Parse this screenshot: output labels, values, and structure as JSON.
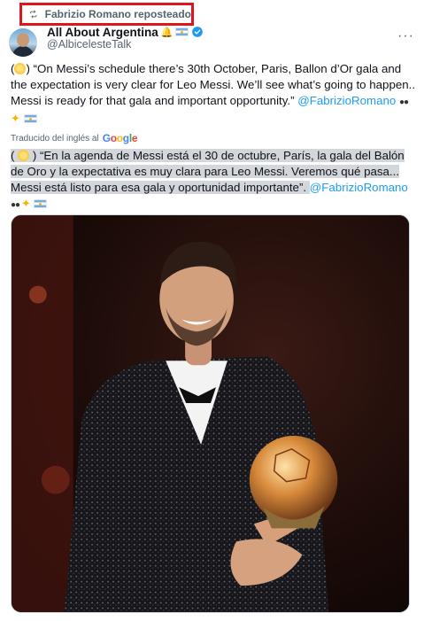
{
  "repost": {
    "label": "Fabrizio Romano reposteado",
    "icon": "repost-icon"
  },
  "author": {
    "display_name": "All About Argentina",
    "handle": "@AlbicelesteTalk",
    "badges": [
      "bell-icon",
      "argentina-flag-icon",
      "verified-badge-icon"
    ],
    "verified_color": "#1d9bf0"
  },
  "more_label": "···",
  "tweet": {
    "open_paren": "(",
    "close_paren": ")",
    "text": "“On Messi’s schedule there’s 30th October, Paris, Ballon d’Or gala and the expectation is very clear for Leo Messi. We’ll see what’s going to happen.. Messi is ready for that gala and important opportunity.”",
    "mention": "@FabrizioRomano"
  },
  "translation": {
    "label": "Traducido del inglés al",
    "provider": "Google",
    "text": "“En la agenda de Messi está el 30 de octubre, París, la gala del Balón de Oro y la expectativa es muy clara para Leo Messi. Veremos qué pasa... Messi está listo para esa gala y oportunidad importante”.",
    "mention": "@FabrizioRomano"
  },
  "colors": {
    "accent": "#1d9bf0",
    "muted": "#536471",
    "highlight_box": "#e0141e",
    "selection": "#d3d6da"
  }
}
